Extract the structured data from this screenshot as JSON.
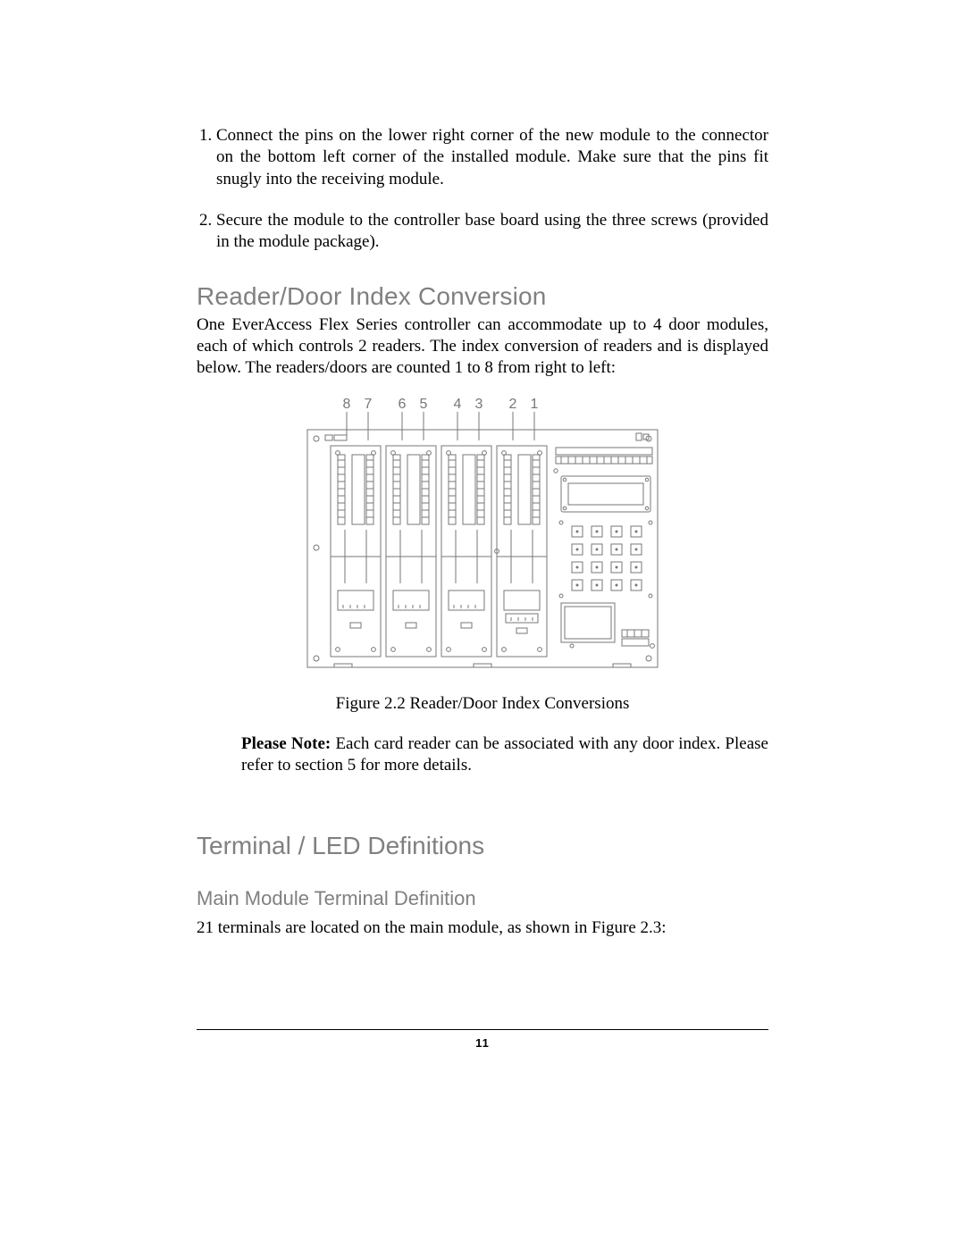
{
  "list": {
    "item1": "Connect the pins on the lower right corner of the new module to the connector on the bottom left corner of the installed module. Make sure that the pins fit snugly into the receiving module.",
    "item2": "Secure the module to the controller base board using the three screws (provided in the module package)."
  },
  "section1": {
    "title": "Reader/Door Index Conversion",
    "body": "One EverAccess Flex Series controller can accommodate up to 4 door modules, each of which controls 2 readers. The index conversion of readers and is displayed below.  The readers/doors are counted 1 to 8 from right to left:"
  },
  "figure": {
    "labels": [
      "8",
      "7",
      "6",
      "5",
      "4",
      "3",
      "2",
      "1"
    ],
    "caption": "Figure 2.2 Reader/Door Index Conversions"
  },
  "note": {
    "label": "Please Note:",
    "text": " Each card reader can be associated with any door index. Please refer to section 5 for more details."
  },
  "section2": {
    "title": "Terminal / LED Definitions"
  },
  "subsection": {
    "title": "Main Module Terminal Definition",
    "body": "21 terminals are located on the main module, as shown in Figure 2.3:"
  },
  "page_number": "11"
}
